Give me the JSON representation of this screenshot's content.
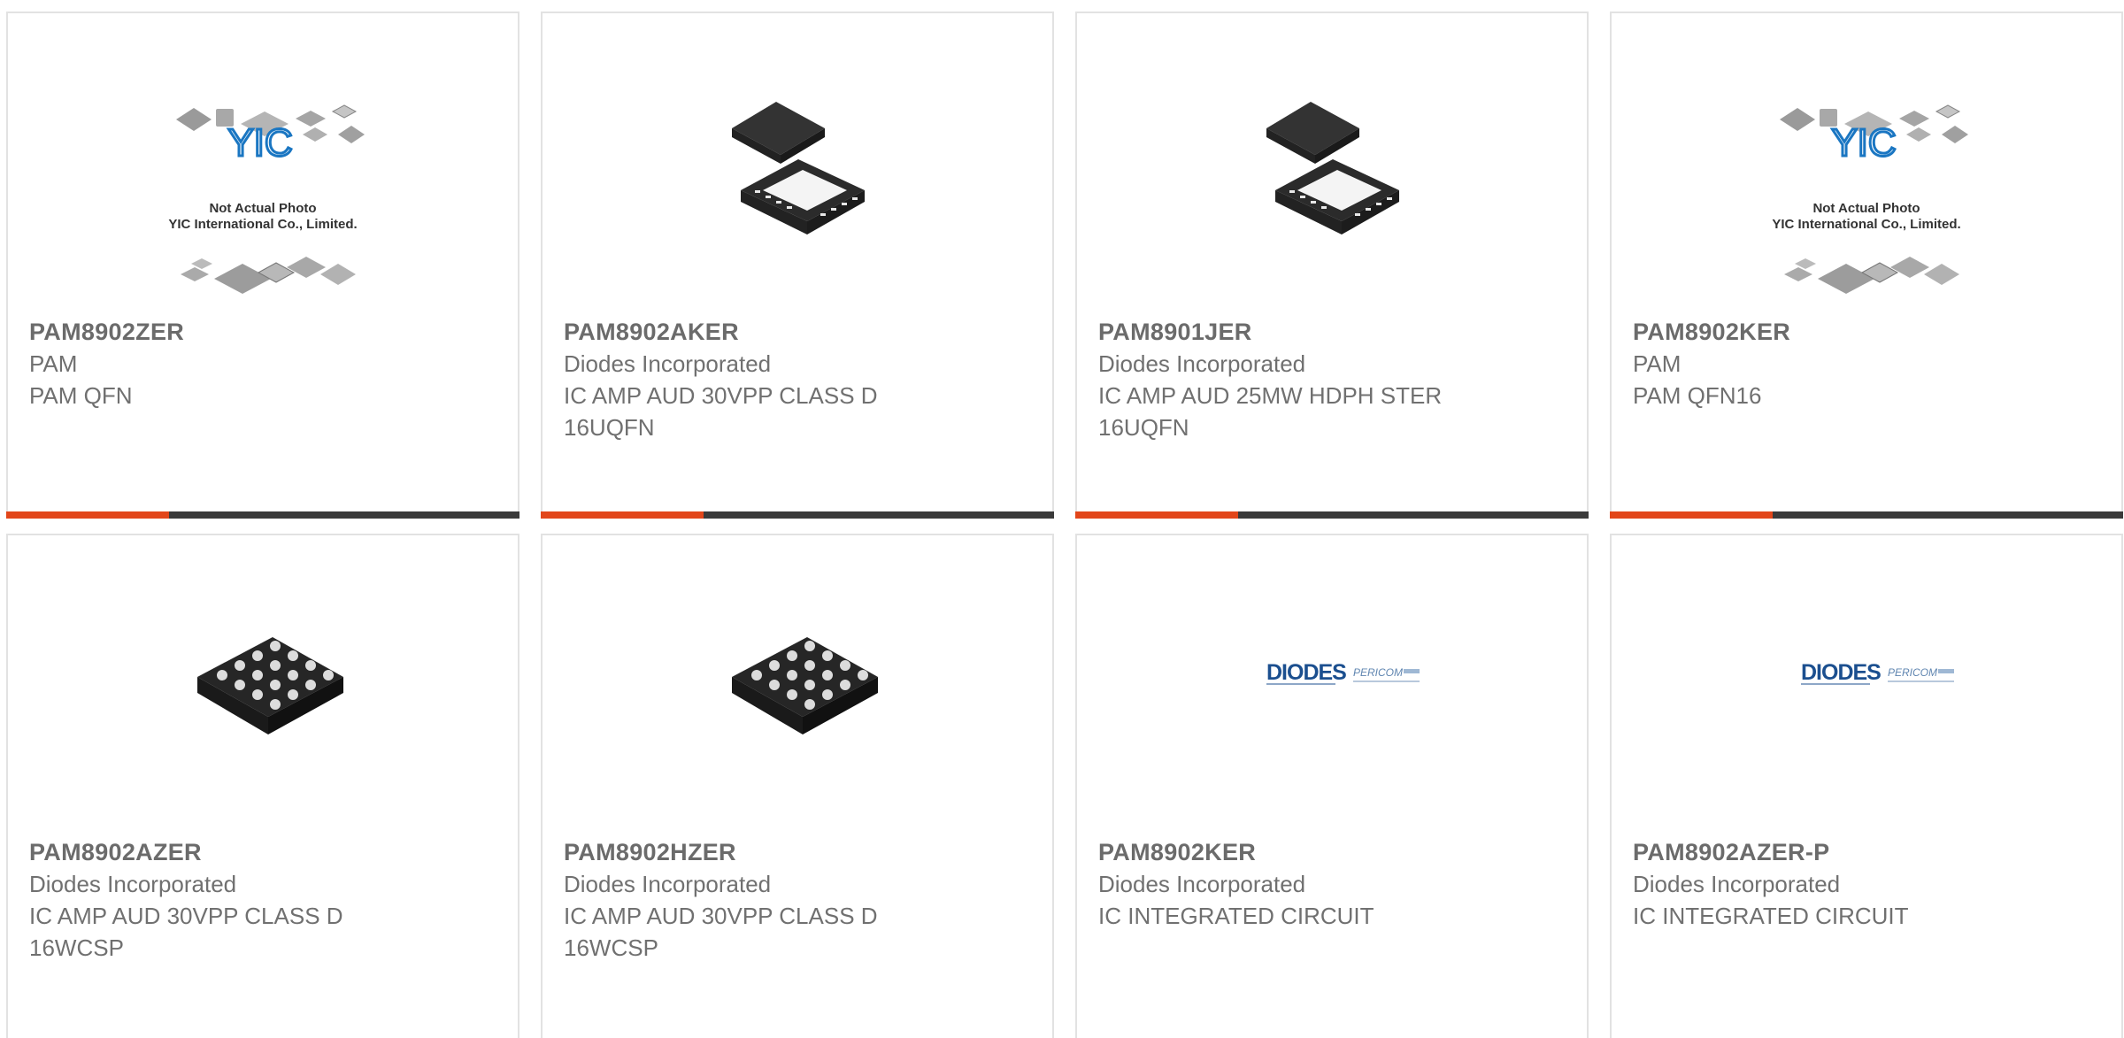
{
  "cards": [
    {
      "part": "PAM8902ZER",
      "manufacturer": "PAM",
      "description": "PAM QFN",
      "image": "yic-placeholder-image",
      "placeholder": {
        "line1": "Not Actual Photo",
        "line2": "YIC International Co., Limited.",
        "logo": "YIC"
      }
    },
    {
      "part": "PAM8902AKER",
      "manufacturer": "Diodes Incorporated",
      "description": "IC AMP AUD 30VPP CLASS D 16UQFN",
      "image": "qfn-chip-image"
    },
    {
      "part": "PAM8901JER",
      "manufacturer": "Diodes Incorporated",
      "description": "IC AMP AUD 25MW HDPH STER 16UQFN",
      "image": "qfn-chip-image"
    },
    {
      "part": "PAM8902KER",
      "manufacturer": "PAM",
      "description": "PAM QFN16",
      "image": "yic-placeholder-image",
      "placeholder": {
        "line1": "Not Actual Photo",
        "line2": "YIC International Co., Limited.",
        "logo": "YIC"
      }
    },
    {
      "part": "PAM8902AZER",
      "manufacturer": "Diodes Incorporated",
      "description": "IC AMP AUD 30VPP CLASS D 16WCSP",
      "image": "wcsp-chip-image"
    },
    {
      "part": "PAM8902HZER",
      "manufacturer": "Diodes Incorporated",
      "description": "IC AMP AUD 30VPP CLASS D 16WCSP",
      "image": "wcsp-chip-image"
    },
    {
      "part": "PAM8902KER",
      "manufacturer": "Diodes Incorporated",
      "description": "IC INTEGRATED CIRCUIT",
      "image": "diodes-pericom-logo",
      "logo": {
        "brand": "DIODES",
        "sub": "PERICOM"
      }
    },
    {
      "part": "PAM8902AZER-P",
      "manufacturer": "Diodes Incorporated",
      "description": "IC INTEGRATED CIRCUIT",
      "image": "diodes-pericom-logo",
      "logo": {
        "brand": "DIODES",
        "sub": "PERICOM"
      }
    }
  ],
  "colors": {
    "accent": "#e2461a",
    "bar": "#3a3a3a",
    "text": "#707070",
    "border": "#e2e2e2"
  }
}
